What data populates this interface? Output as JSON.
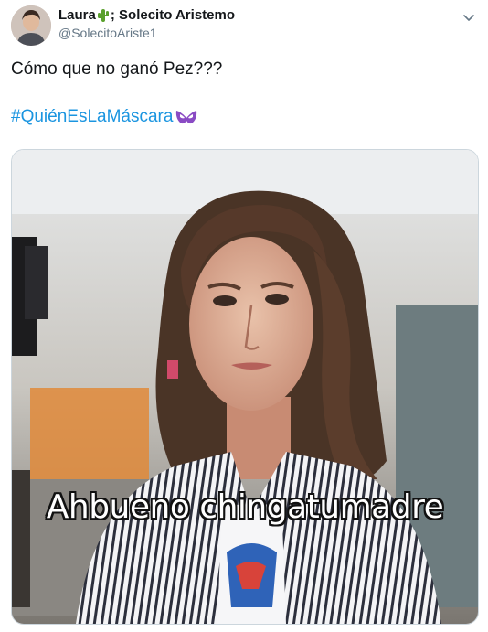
{
  "author": {
    "display_name_part1": "Laura",
    "display_name_part2": "; Solecito Aristemo",
    "handle": "@SolecitoAriste1",
    "emoji": "cactus-icon"
  },
  "tweet": {
    "text": "Cómo que no ganó Pez???",
    "hashtag": "#QuiénEsLaMáscara",
    "hashtag_emoji": "mask-icon"
  },
  "media": {
    "caption": "Ahbueno chingatumadre"
  },
  "colors": {
    "text": "#14171a",
    "secondary": "#657786",
    "link": "#1b95e0",
    "border": "#ccd6dd",
    "mask": "#8a4bc4"
  }
}
